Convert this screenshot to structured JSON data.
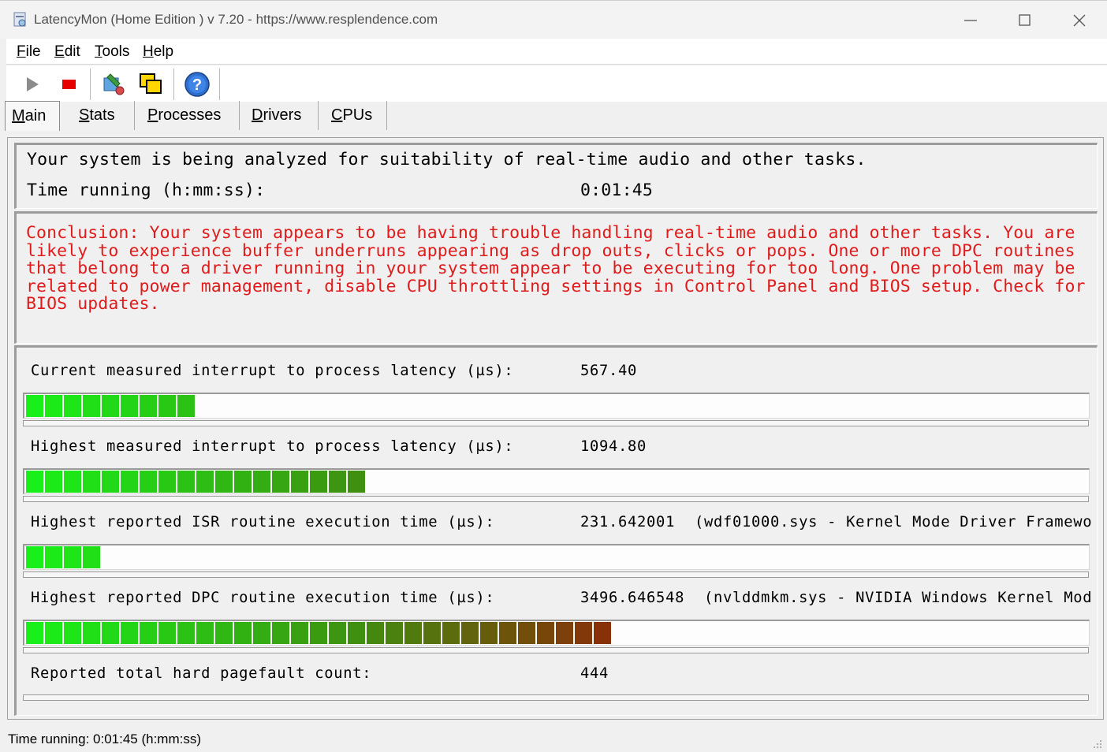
{
  "window": {
    "title": "LatencyMon  (Home Edition )  v 7.20 - https://www.resplendence.com"
  },
  "menu": {
    "items": [
      {
        "label": "File",
        "key": "F",
        "rest": "ile"
      },
      {
        "label": "Edit",
        "key": "E",
        "rest": "dit"
      },
      {
        "label": "Tools",
        "key": "T",
        "rest": "ools"
      },
      {
        "label": "Help",
        "key": "H",
        "rest": "elp"
      }
    ]
  },
  "toolbar": {
    "icons": [
      "play-icon",
      "stop-icon",
      "analyze-icon",
      "windows-icon",
      "help-icon"
    ]
  },
  "tabs": [
    {
      "label": "Main",
      "key": "M",
      "rest": "ain",
      "active": true
    },
    {
      "label": "Stats",
      "key": "S",
      "rest": "tats"
    },
    {
      "label": "Processes",
      "key": "P",
      "rest": "rocesses"
    },
    {
      "label": "Drivers",
      "key": "D",
      "rest": "rivers"
    },
    {
      "label": "CPUs",
      "key": "C",
      "rest": "PUs"
    }
  ],
  "summary": {
    "line1": "Your system is being analyzed for suitability of real-time audio and other tasks.",
    "time_label": "Time running (h:mm:ss):",
    "time_value": "0:01:45"
  },
  "conclusion": "Conclusion: Your system appears to be having trouble handling real-time audio and other tasks. You are likely to experience buffer underruns appearing as drop outs, clicks or pops. One or more DPC routines that belong to a driver running in your system appear to be executing for too long. One problem may be related to power management, disable CPU throttling settings in Control Panel and BIOS setup. Check for BIOS updates.",
  "metrics": [
    {
      "label": "Current measured interrupt to process latency (µs):",
      "value": "567.40",
      "extra": "",
      "segments": 9
    },
    {
      "label": "Highest measured interrupt to process latency (µs):",
      "value": "1094.80",
      "extra": "",
      "segments": 18
    },
    {
      "label": "Highest reported ISR routine execution time (µs):",
      "value": "231.642001",
      "extra": "(wdf01000.sys - Kernel Mode Driver Framewo",
      "segments": 4
    },
    {
      "label": "Highest reported DPC routine execution time (µs):",
      "value": "3496.646548",
      "extra": "(nvlddmkm.sys - NVIDIA Windows Kernel Mod",
      "segments": 31
    },
    {
      "label": "Reported total hard pagefault count:",
      "value": "444",
      "extra": "",
      "segments": 0
    }
  ],
  "meter_colors": {
    "start": "#19f019",
    "mid": "#3f8f10",
    "end": "#8e2a08"
  },
  "statusbar": {
    "text": "Time running: 0:01:45  (h:mm:ss)"
  }
}
